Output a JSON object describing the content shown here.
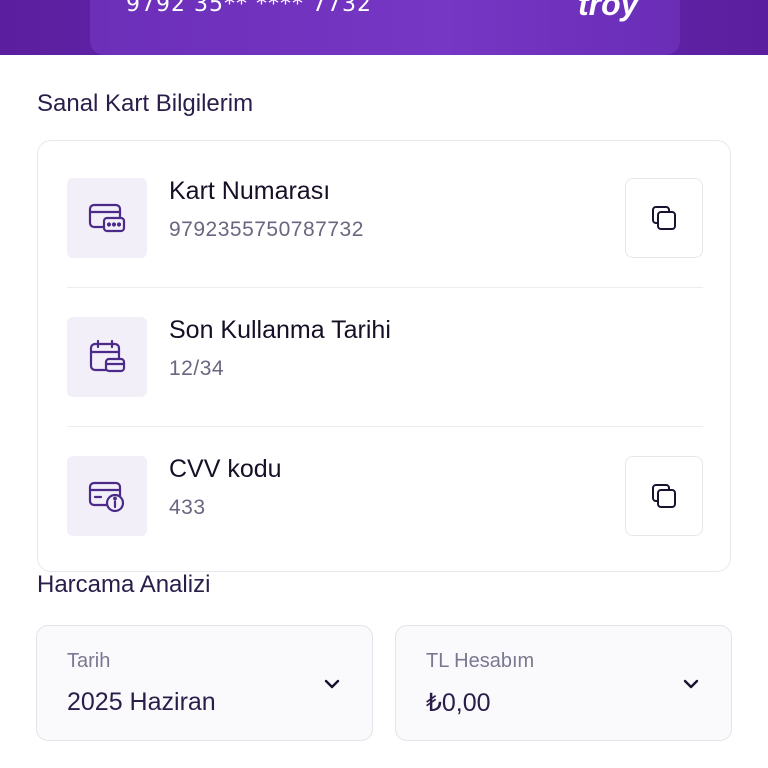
{
  "card": {
    "masked_number": "9792 35** **** 7732",
    "brand": "troy"
  },
  "virtual_card": {
    "title": "Sanal Kart Bilgilerim",
    "rows": [
      {
        "label": "Kart Numarası",
        "value": "9792355750787732",
        "icon": "card-icon",
        "copyable": true
      },
      {
        "label": "Son Kullanma Tarihi",
        "value": "12/34",
        "icon": "card-calendar-icon",
        "copyable": false
      },
      {
        "label": "CVV kodu",
        "value": "433",
        "icon": "card-info-icon",
        "copyable": true
      }
    ]
  },
  "spending_analysis": {
    "title": "Harcama Analizi",
    "date_select": {
      "label": "Tarih",
      "value": "2025 Haziran"
    },
    "account_select": {
      "label": "TL Hesabım",
      "value": "₺0,00"
    }
  },
  "colors": {
    "brand_purple": "#5a1e9e",
    "icon_purple": "#4b2a8a",
    "icon_bg": "#f2eff8"
  }
}
